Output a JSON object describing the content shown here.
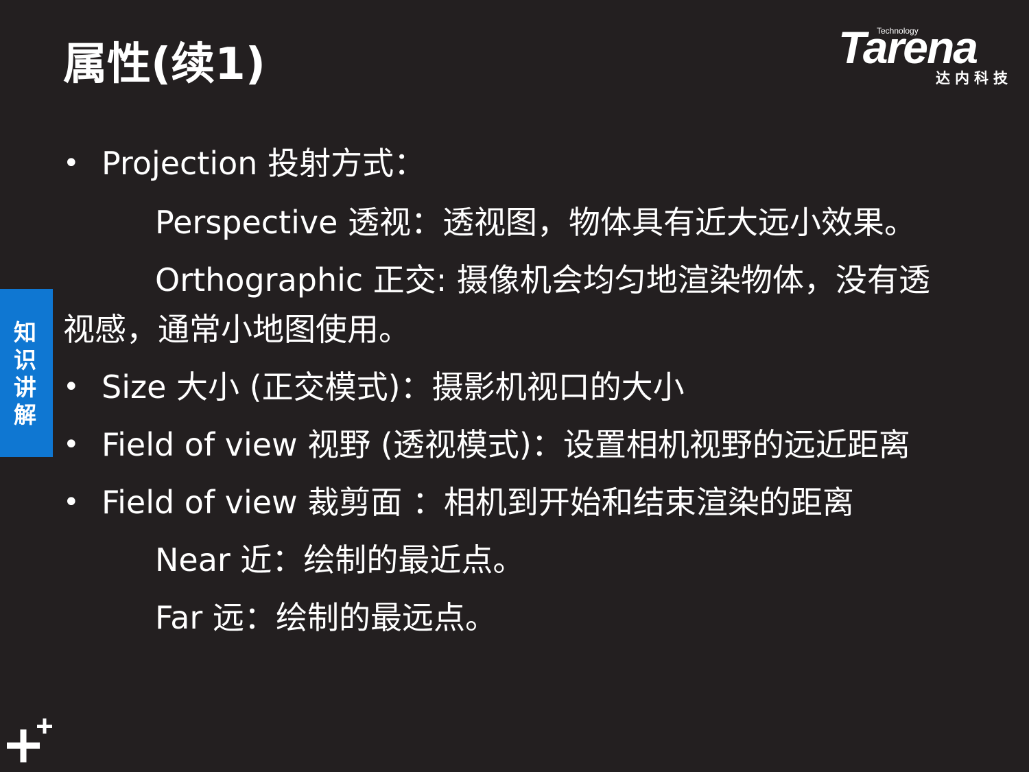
{
  "slide": {
    "title": "属性(续1)",
    "bullets": [
      "Projection 投射方式：",
      "Size 大小 (正交模式)：摄影机视口的大小",
      "Field of view 视野 (透视模式)：设置相机视野的远近距离",
      "Field of view 裁剪面 ：相机到开始和结束渲染的距离"
    ],
    "sub_lines": {
      "perspective": "Perspective 透视：透视图，物体具有近大远小效果。",
      "orthographic": "Orthographic 正交: 摄像机会均匀地渲染物体，没有透",
      "orthographic_cont": "视感，通常小地图使用。",
      "near": "Near 近：绘制的最近点。",
      "far": "Far 远：绘制的最远点。"
    }
  },
  "logo": {
    "wordmark": "Tarena",
    "tagline": "Technology",
    "chinese": "达内科技"
  },
  "side_tab": {
    "label": "知识讲解"
  },
  "colors": {
    "background": "#231f20",
    "text": "#ffffff",
    "tab": "#0f77d2"
  },
  "icons": {
    "bullet": "•",
    "corner": "plus-icon"
  }
}
